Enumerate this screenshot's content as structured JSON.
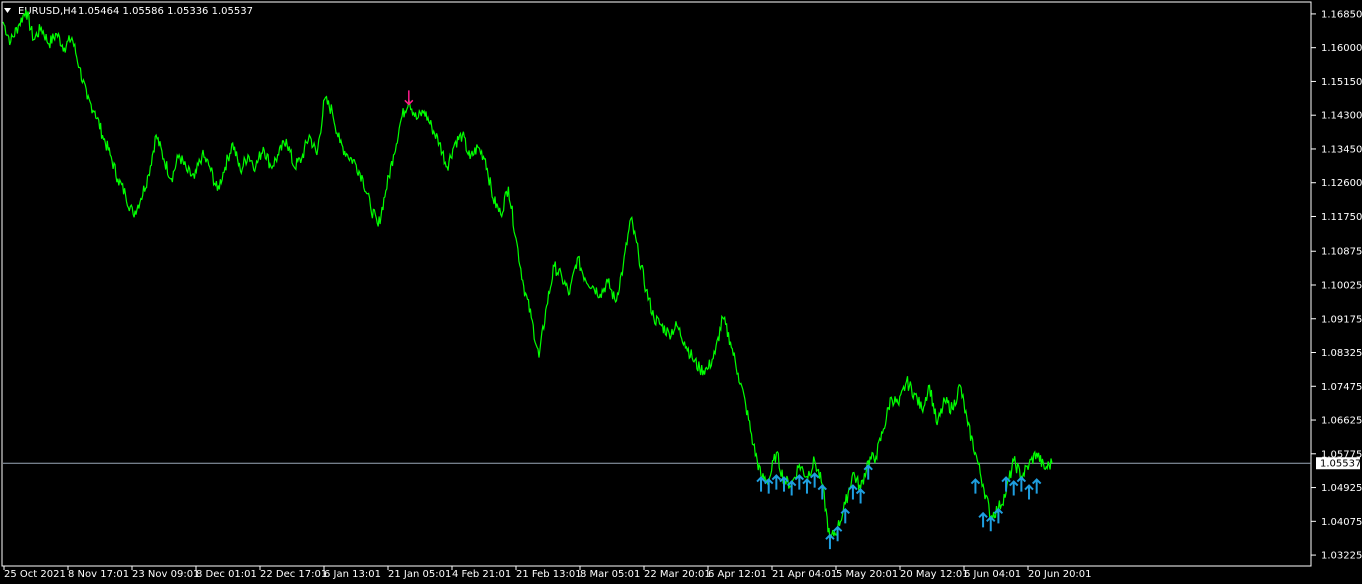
{
  "header": {
    "symbol": "EURUSD,H4",
    "ohlc": "1.05464 1.05586 1.05336 1.05537"
  },
  "colors": {
    "background": "#000000",
    "price_line": "#00ff00",
    "axis": "#ffffff",
    "current_price_line": "#9aa8b8",
    "buy_arrow": "#1e9fe0",
    "sell_arrow": "#ff1a8c"
  },
  "chart_data": {
    "type": "line",
    "title": "EURUSD,H4",
    "ylim": [
      1.0295,
      1.1715
    ],
    "grid": false,
    "current_price": 1.05537,
    "current_price_label": "1.05537",
    "y_ticks": [
      "1.16850",
      "1.16000",
      "1.15150",
      "1.14300",
      "1.13450",
      "1.12600",
      "1.11750",
      "1.10875",
      "1.10025",
      "1.09175",
      "1.08325",
      "1.07475",
      "1.06625",
      "1.05775",
      "1.04925",
      "1.04075",
      "1.03225"
    ],
    "x_ticks": [
      "25 Oct 2021",
      "8 Nov 17:01",
      "23 Nov 09:01",
      "8 Dec 01:01",
      "22 Dec 17:01",
      "6 Jan 13:01",
      "21 Jan 05:01",
      "4 Feb 21:01",
      "21 Feb 13:01",
      "8 Mar 05:01",
      "22 Mar 20:01",
      "6 Apr 12:01",
      "21 Apr 04:01",
      "5 May 20:01",
      "20 May 12:01",
      "6 Jun 04:01",
      "20 Jun 20:01"
    ],
    "series": [
      {
        "values": [
          1.1665,
          1.1615,
          1.1655,
          1.1695,
          1.162,
          1.165,
          1.161,
          1.1635,
          1.16,
          1.1625,
          1.155,
          1.147,
          1.144,
          1.138,
          1.133,
          1.127,
          1.123,
          1.118,
          1.122,
          1.128,
          1.138,
          1.132,
          1.127,
          1.133,
          1.129,
          1.127,
          1.133,
          1.13,
          1.124,
          1.13,
          1.136,
          1.129,
          1.133,
          1.13,
          1.135,
          1.13,
          1.133,
          1.137,
          1.13,
          1.132,
          1.138,
          1.133,
          1.147,
          1.144,
          1.136,
          1.133,
          1.131,
          1.127,
          1.12,
          1.115,
          1.124,
          1.133,
          1.142,
          1.147,
          1.142,
          1.144,
          1.14,
          1.136,
          1.13,
          1.136,
          1.138,
          1.132,
          1.135,
          1.132,
          1.122,
          1.118,
          1.125,
          1.112,
          1.1,
          1.092,
          1.082,
          1.095,
          1.105,
          1.102,
          1.098,
          1.107,
          1.102,
          1.1,
          1.098,
          1.101,
          1.096,
          1.105,
          1.117,
          1.108,
          1.099,
          1.092,
          1.09,
          1.088,
          1.09,
          1.086,
          1.082,
          1.079,
          1.079,
          1.083,
          1.092,
          1.086,
          1.078,
          1.07,
          1.06,
          1.052,
          1.051,
          1.058,
          1.051,
          1.05,
          1.055,
          1.052,
          1.056,
          1.05,
          1.036,
          1.039,
          1.045,
          1.053,
          1.049,
          1.056,
          1.057,
          1.064,
          1.072,
          1.07,
          1.076,
          1.073,
          1.069,
          1.075,
          1.065,
          1.071,
          1.069,
          1.075,
          1.065,
          1.058,
          1.05,
          1.042,
          1.044,
          1.048,
          1.056,
          1.052,
          1.055,
          1.058,
          1.054,
          1.0554
        ]
      }
    ],
    "sell_signals": [
      {
        "x_index": 53,
        "value": 1.1475
      }
    ],
    "buy_signals": [
      {
        "x_index": 99,
        "value": 1.05
      },
      {
        "x_index": 100,
        "value": 1.0495
      },
      {
        "x_index": 101,
        "value": 1.0505
      },
      {
        "x_index": 102,
        "value": 1.05
      },
      {
        "x_index": 103,
        "value": 1.049
      },
      {
        "x_index": 104,
        "value": 1.0505
      },
      {
        "x_index": 105,
        "value": 1.0495
      },
      {
        "x_index": 106,
        "value": 1.051
      },
      {
        "x_index": 107,
        "value": 1.048
      },
      {
        "x_index": 108,
        "value": 1.0355
      },
      {
        "x_index": 109,
        "value": 1.0375
      },
      {
        "x_index": 110,
        "value": 1.042
      },
      {
        "x_index": 111,
        "value": 1.048
      },
      {
        "x_index": 112,
        "value": 1.047
      },
      {
        "x_index": 113,
        "value": 1.053
      },
      {
        "x_index": 127,
        "value": 1.0495
      },
      {
        "x_index": 128,
        "value": 1.041
      },
      {
        "x_index": 129,
        "value": 1.04
      },
      {
        "x_index": 130,
        "value": 1.042
      },
      {
        "x_index": 131,
        "value": 1.05
      },
      {
        "x_index": 132,
        "value": 1.049
      },
      {
        "x_index": 133,
        "value": 1.05
      },
      {
        "x_index": 134,
        "value": 1.048
      },
      {
        "x_index": 135,
        "value": 1.0495
      }
    ]
  }
}
